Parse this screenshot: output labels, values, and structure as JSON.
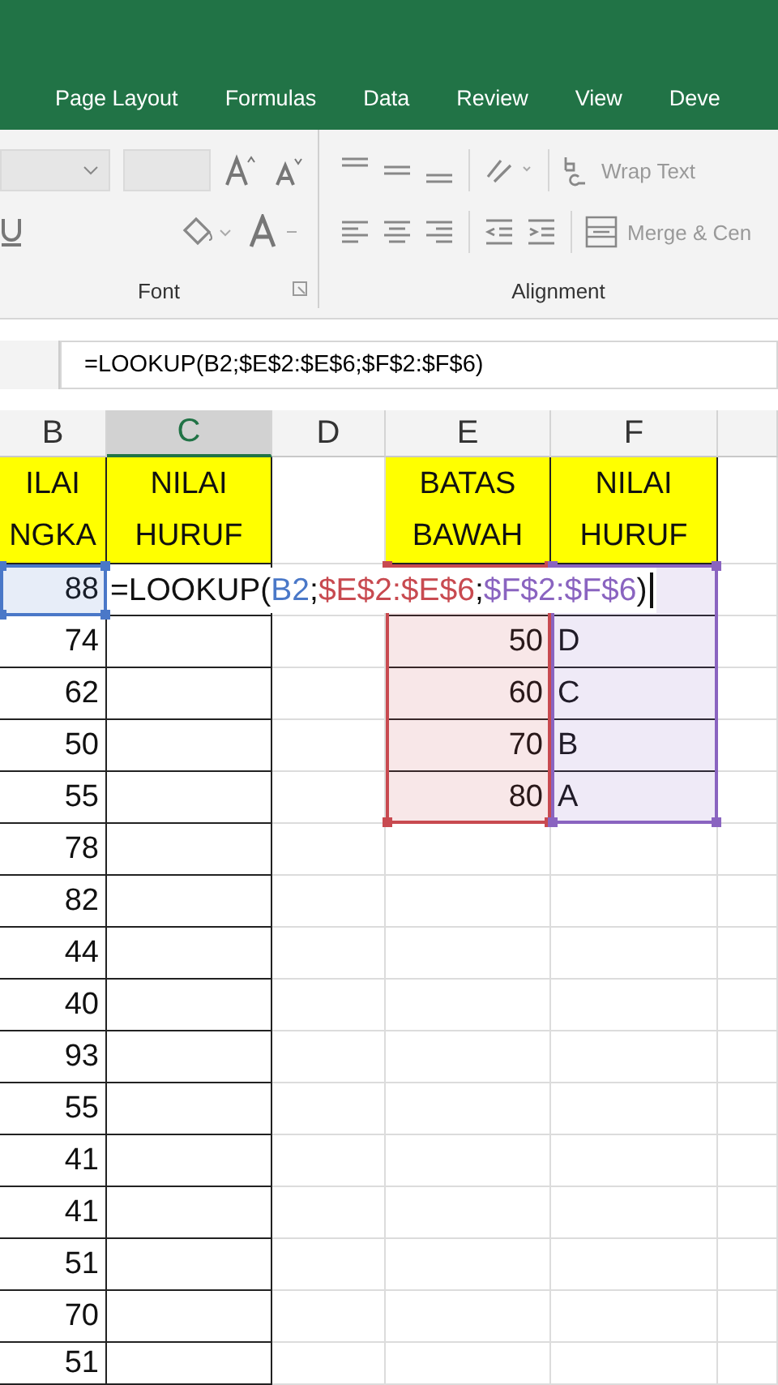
{
  "ribbon_tabs": [
    {
      "label": "Page Layout"
    },
    {
      "label": "Formulas"
    },
    {
      "label": "Data"
    },
    {
      "label": "Review"
    },
    {
      "label": "View"
    },
    {
      "label": "Deve"
    }
  ],
  "ribbon": {
    "font_group": {
      "label": "Font"
    },
    "alignment_group": {
      "label": "Alignment",
      "wrap_text": "Wrap Text",
      "merge": "Merge & Cen"
    }
  },
  "formula_bar": {
    "value": "=LOOKUP(B2;$E$2:$E$6;$F$2:$F$6)"
  },
  "columns": [
    {
      "label": "B",
      "selected": false
    },
    {
      "label": "C",
      "selected": true
    },
    {
      "label": "D",
      "selected": false
    },
    {
      "label": "E",
      "selected": false
    },
    {
      "label": "F",
      "selected": false
    }
  ],
  "rows": [
    [
      {
        "text": "ILAI NGKA",
        "kind": "header",
        "color": "#ffff00"
      },
      {
        "text": "NILAI HURUF",
        "kind": "header",
        "color": "#ffff00"
      },
      null,
      {
        "text": "BATAS BAWAH",
        "kind": "header",
        "color": "#ffff00"
      },
      {
        "text": "NILAI HURUF",
        "kind": "header",
        "color": "#ffff00"
      }
    ],
    [
      {
        "text": "88",
        "kind": "number",
        "color": "#4a78c8"
      },
      {
        "kind": "empty"
      },
      null,
      {
        "kind": "empty",
        "color": "#c84a50"
      },
      {
        "kind": "empty",
        "color": "#8a64c0"
      }
    ],
    [
      {
        "text": "74",
        "kind": "number"
      },
      {
        "kind": "empty"
      },
      null,
      {
        "text": "50",
        "kind": "number",
        "color": "#c84a50"
      },
      {
        "text": "D",
        "kind": "text",
        "color": "#8a64c0"
      }
    ],
    [
      {
        "text": "62",
        "kind": "number"
      },
      {
        "kind": "empty"
      },
      null,
      {
        "text": "60",
        "kind": "number",
        "color": "#c84a50"
      },
      {
        "text": "C",
        "kind": "text",
        "color": "#8a64c0"
      }
    ],
    [
      {
        "text": "50",
        "kind": "number"
      },
      {
        "kind": "empty"
      },
      null,
      {
        "text": "70",
        "kind": "number",
        "color": "#c84a50"
      },
      {
        "text": "B",
        "kind": "text",
        "color": "#8a64c0"
      }
    ],
    [
      {
        "text": "55",
        "kind": "number"
      },
      {
        "kind": "empty"
      },
      null,
      {
        "text": "80",
        "kind": "number",
        "color": "#c84a50"
      },
      {
        "text": "A",
        "kind": "text",
        "color": "#8a64c0"
      }
    ],
    [
      {
        "text": "78",
        "kind": "number"
      },
      {
        "kind": "empty"
      },
      null,
      null,
      null
    ],
    [
      {
        "text": "82",
        "kind": "number"
      },
      {
        "kind": "empty"
      },
      null,
      null,
      null
    ],
    [
      {
        "text": "44",
        "kind": "number"
      },
      {
        "kind": "empty"
      },
      null,
      null,
      null
    ],
    [
      {
        "text": "40",
        "kind": "number"
      },
      {
        "kind": "empty"
      },
      null,
      null,
      null
    ],
    [
      {
        "text": "93",
        "kind": "number"
      },
      {
        "kind": "empty"
      },
      null,
      null,
      null
    ],
    [
      {
        "text": "55",
        "kind": "number"
      },
      {
        "kind": "empty"
      },
      null,
      null,
      null
    ],
    [
      {
        "text": "41",
        "kind": "number"
      },
      {
        "kind": "empty"
      },
      null,
      null,
      null
    ],
    [
      {
        "text": "41",
        "kind": "number"
      },
      {
        "kind": "empty"
      },
      null,
      null,
      null
    ],
    [
      {
        "text": "51",
        "kind": "number"
      },
      {
        "kind": "empty"
      },
      null,
      null,
      null
    ],
    [
      {
        "text": "70",
        "kind": "number"
      },
      {
        "kind": "empty"
      },
      null,
      null,
      null
    ],
    [
      {
        "text": "51",
        "kind": "number"
      },
      {
        "kind": "empty"
      },
      null,
      null,
      null
    ]
  ],
  "cell_editor": {
    "segments": [
      {
        "text": "=LOOKUP("
      },
      {
        "text": "B2",
        "color": "#4a78c8"
      },
      {
        "text": ";"
      },
      {
        "text": "$E$2:$E$6",
        "color": "#c84a50"
      },
      {
        "text": ";"
      },
      {
        "text": "$F$2:$F$6",
        "color": "#8a64c0"
      },
      {
        "text": ")"
      }
    ]
  }
}
